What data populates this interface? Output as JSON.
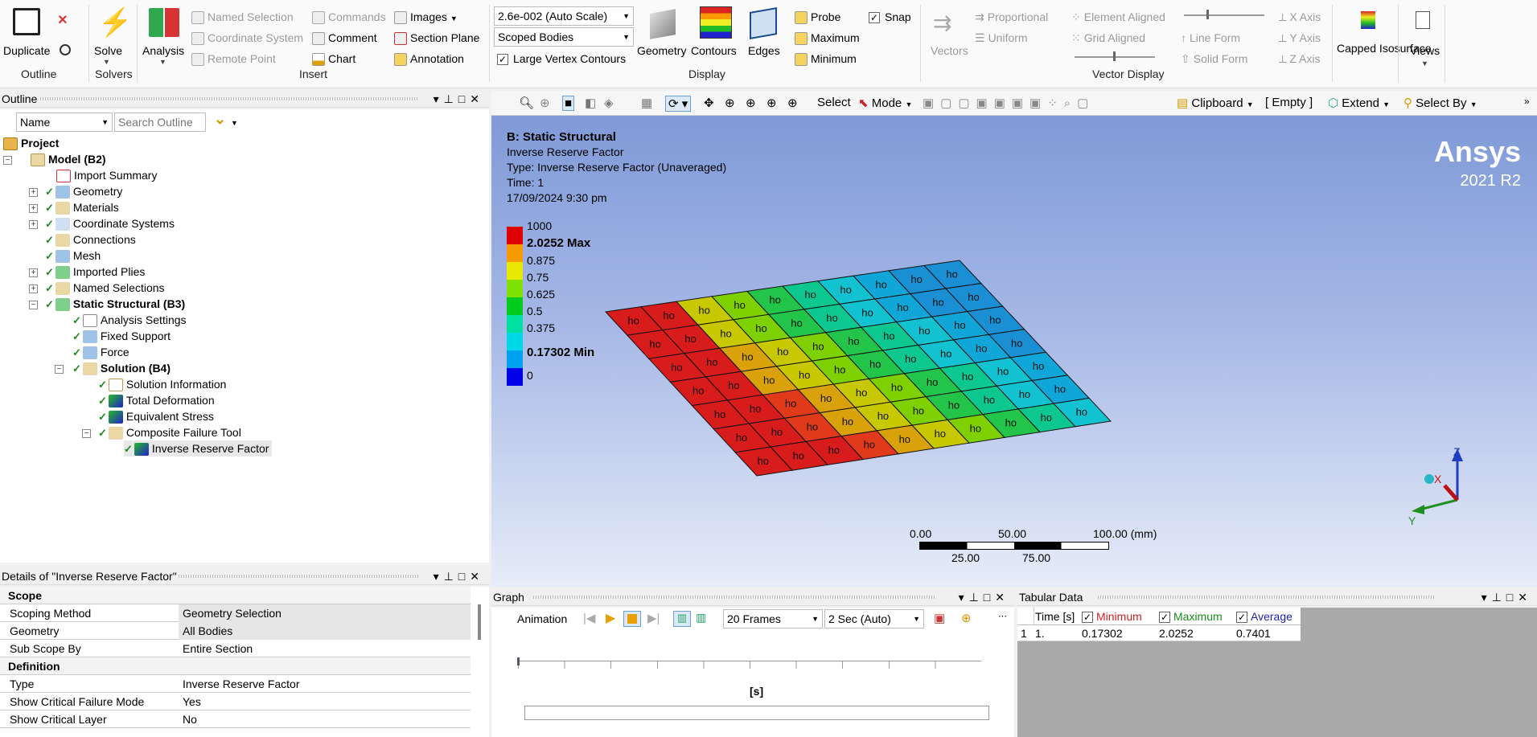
{
  "ribbon": {
    "duplicate": "Duplicate",
    "solve": "Solve",
    "analysis": "Analysis",
    "named_selection": "Named Selection",
    "coordinate_system": "Coordinate System",
    "remote_point": "Remote Point",
    "commands": "Commands",
    "comment": "Comment",
    "chart": "Chart",
    "images": "Images",
    "section_plane": "Section Plane",
    "annotation": "Annotation",
    "scale_select": "2.6e-002 (Auto Scale)",
    "scope_select": "Scoped Bodies",
    "large_vertex": "Large Vertex Contours",
    "geometry": "Geometry",
    "contours": "Contours",
    "edges": "Edges",
    "probe": "Probe",
    "maximum": "Maximum",
    "minimum": "Minimum",
    "snap": "Snap",
    "vectors": "Vectors",
    "proportional": "Proportional",
    "uniform": "Uniform",
    "element_aligned": "Element Aligned",
    "grid_aligned": "Grid Aligned",
    "line_form": "Line Form",
    "solid_form": "Solid Form",
    "x_axis": "X Axis",
    "y_axis": "Y Axis",
    "z_axis": "Z Axis",
    "capped_isosurface": "Capped Isosurface",
    "views": "Views",
    "groups": {
      "outline": "Outline",
      "solvers": "Solvers",
      "insert": "Insert",
      "display": "Display",
      "vector_display": "Vector Display"
    }
  },
  "outline": {
    "title": "Outline",
    "filter_select": "Name",
    "search_placeholder": "Search Outline",
    "tree": [
      {
        "label": "Project"
      },
      {
        "label": "Model (B2)"
      },
      {
        "label": "Import Summary"
      },
      {
        "label": "Geometry"
      },
      {
        "label": "Materials"
      },
      {
        "label": "Coordinate Systems"
      },
      {
        "label": "Connections"
      },
      {
        "label": "Mesh"
      },
      {
        "label": "Imported Plies"
      },
      {
        "label": "Named Selections"
      },
      {
        "label": "Static Structural (B3)"
      },
      {
        "label": "Analysis Settings"
      },
      {
        "label": "Fixed Support"
      },
      {
        "label": "Force"
      },
      {
        "label": "Solution (B4)"
      },
      {
        "label": "Solution Information"
      },
      {
        "label": "Total Deformation"
      },
      {
        "label": "Equivalent Stress"
      },
      {
        "label": "Composite Failure Tool"
      },
      {
        "label": "Inverse Reserve Factor"
      }
    ]
  },
  "viewport_toolbar": {
    "select": "Select",
    "mode": "Mode",
    "clipboard": "Clipboard",
    "empty": "[ Empty ]",
    "extend": "Extend",
    "select_by": "Select By"
  },
  "viewport": {
    "title": "B: Static Structural",
    "line2": "Inverse Reserve Factor",
    "line3": "Type: Inverse Reserve Factor (Unaveraged)",
    "line4": "Time: 1",
    "line5": "17/09/2024 9:30 pm",
    "brand": "Ansys",
    "version": "2021 R2",
    "legend": [
      "1000",
      "2.0252 Max",
      "0.875",
      "0.75",
      "0.625",
      "0.5",
      "0.375",
      "0.17302 Min",
      "0"
    ],
    "cell_label": "ho",
    "scale_top": [
      "0.00",
      "50.00",
      "100.00 (mm)"
    ],
    "scale_bottom": [
      "25.00",
      "75.00"
    ],
    "triad": {
      "z": "Z",
      "x": "X",
      "y": "Y"
    }
  },
  "details": {
    "title": "Details of \"Inverse Reserve Factor\"",
    "rows": [
      {
        "k": "Scope",
        "v": ""
      },
      {
        "k": "Scoping Method",
        "v": "Geometry Selection"
      },
      {
        "k": "Geometry",
        "v": "All Bodies"
      },
      {
        "k": "Sub Scope By",
        "v": "Entire Section"
      },
      {
        "k": "Definition",
        "v": ""
      },
      {
        "k": "Type",
        "v": "Inverse Reserve Factor"
      },
      {
        "k": "Show Critical Failure Mode",
        "v": "Yes"
      },
      {
        "k": "Show Critical Layer",
        "v": "No"
      }
    ]
  },
  "graph": {
    "title": "Graph",
    "animation": "Animation",
    "frames": "20 Frames",
    "duration": "2 Sec (Auto)",
    "axis_unit": "[s]"
  },
  "tabular": {
    "title": "Tabular Data",
    "headers": [
      "Time [s]",
      "Minimum",
      "Maximum",
      "Average"
    ],
    "row": [
      "1",
      "1.",
      "0.17302",
      "2.0252",
      "0.7401"
    ]
  }
}
